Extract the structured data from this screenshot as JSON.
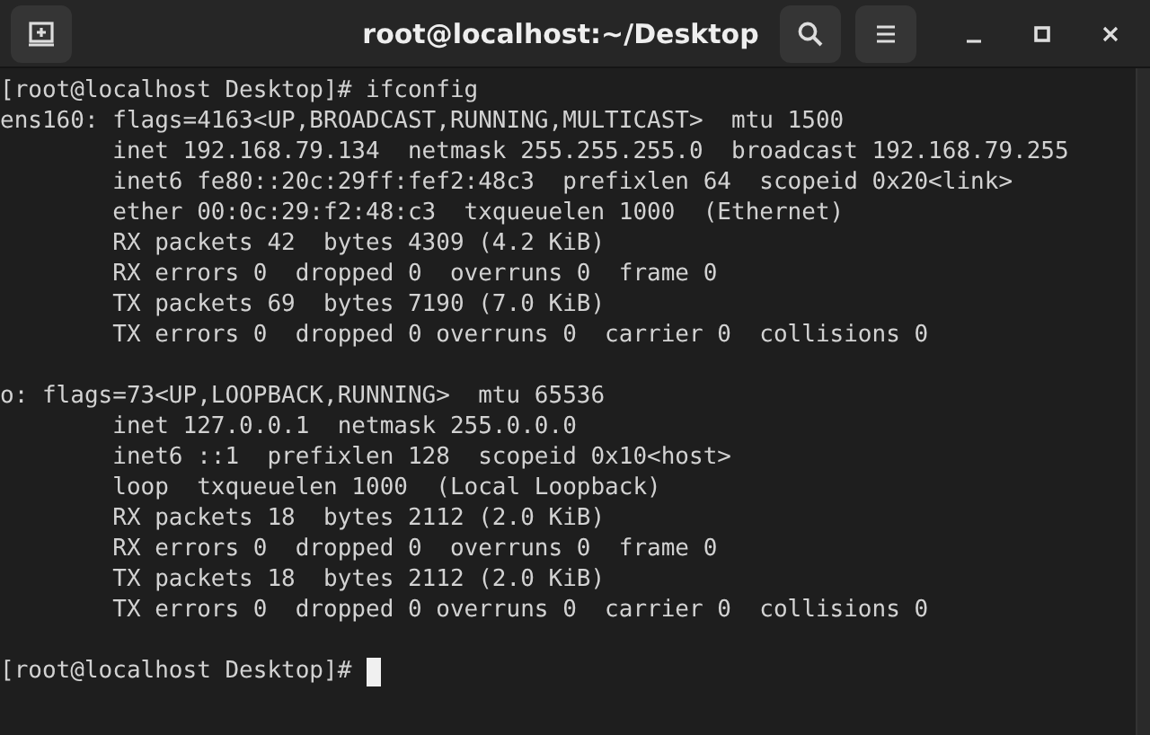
{
  "window": {
    "title": "root@localhost:~/Desktop"
  },
  "terminal": {
    "blocks": [
      [
        "[root@localhost Desktop]# ifconfig",
        "ens160: flags=4163<UP,BROADCAST,RUNNING,MULTICAST>  mtu 1500",
        "        inet 192.168.79.134  netmask 255.255.255.0  broadcast 192.168.79.255",
        "        inet6 fe80::20c:29ff:fef2:48c3  prefixlen 64  scopeid 0x20<link>",
        "        ether 00:0c:29:f2:48:c3  txqueuelen 1000  (Ethernet)",
        "        RX packets 42  bytes 4309 (4.2 KiB)",
        "        RX errors 0  dropped 0  overruns 0  frame 0",
        "        TX packets 69  bytes 7190 (7.0 KiB)",
        "        TX errors 0  dropped 0 overruns 0  carrier 0  collisions 0"
      ],
      [
        "o: flags=73<UP,LOOPBACK,RUNNING>  mtu 65536",
        "        inet 127.0.0.1  netmask 255.0.0.0",
        "        inet6 ::1  prefixlen 128  scopeid 0x10<host>",
        "        loop  txqueuelen 1000  (Local Loopback)",
        "        RX packets 18  bytes 2112 (2.0 KiB)",
        "        RX errors 0  dropped 0  overruns 0  frame 0",
        "        TX packets 18  bytes 2112 (2.0 KiB)",
        "        TX errors 0  dropped 0 overruns 0  carrier 0  collisions 0"
      ]
    ],
    "prompt": "[root@localhost Desktop]# "
  }
}
